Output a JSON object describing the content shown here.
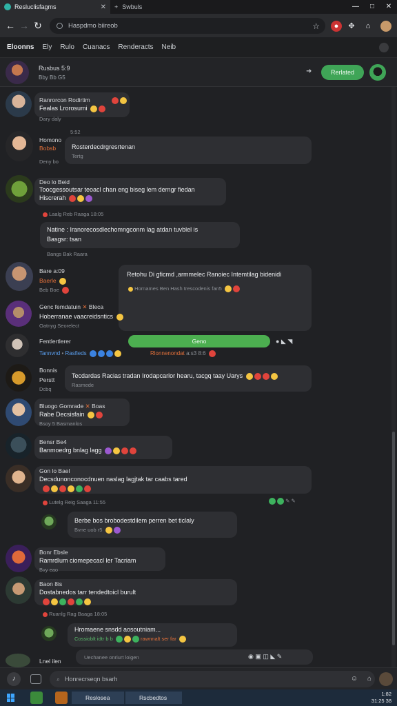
{
  "browser": {
    "active_tab": "Resluclisfagms",
    "inactive_tab": "Swbuls",
    "url": "Haspdmo biireob",
    "window_controls": [
      "—",
      "□",
      "✕"
    ]
  },
  "page_nav": {
    "brand": "Eloonns",
    "links": [
      "Ely",
      "Rulo",
      "Cuanacs",
      "Renderacts",
      "Neib"
    ]
  },
  "chat_header": {
    "name": "Rusbus 5:9",
    "sub": "Bby Bb G5",
    "join_label": "Rerlated"
  },
  "messages": [
    {
      "user": "Ranrorcon Rodirtim",
      "text": "Fealas Lrorosumi",
      "time": "Dary daly"
    },
    {
      "user": "Homono",
      "handle": "Bobsb",
      "time_top": "5:52",
      "text": "Rosterdecdrgresrtenan",
      "sub": "Tertg",
      "time": "Deny bo"
    },
    {
      "user": "Deo lo Beid",
      "text": "Toocgessoutsar teoacl chan eng biseg lem derngr fiedan",
      "text2": "Hiscrerah",
      "meta": "Laalg  Reb  Raaga  18:05"
    },
    {
      "text": "Natine : Iranorecosdlechomngconm lag atdan tuvblel is",
      "text2": "Basgsr: tsan",
      "meta": "Bangs  Bak  Raara"
    },
    {
      "user": "Bare a:09",
      "handle": "Baerle",
      "time": "Beb Boe",
      "reply_text": "Retohu Di gficmd ,armmelec Ranoiec Intemtilag bidenidi",
      "reply_text2": "Hornames  Ben  Hash  trescodenis  fan5"
    },
    {
      "user": "Genc femdatuin",
      "tag": "Bleca",
      "text": "Hoberranae vaacreidsntics",
      "time": "Oatnyg Seorelect"
    },
    {
      "user": "Fentlertlerer",
      "button": "Geno",
      "blue_user": "Tannvnd",
      "blue_time": "Rasfieds",
      "blue_tag": "Rlonnenondat",
      "blue_time2": "a:s3 8:6"
    },
    {
      "user": "Bonnis",
      "handle": "Perstt",
      "text": "Tecdardas Racias tradan Irodapcarlor hearu, tacgq taay Uarys",
      "sub": "Rasmede",
      "time": "Dcbq"
    },
    {
      "user": "Bluogo Gomrade",
      "tag": "Boas",
      "text": "Rabe Decsisfain",
      "time": "Bsoy 5 Basmanlos"
    },
    {
      "user": "Bensr Be4",
      "text": "Banmoedrg bnlag lagg",
      "time": ""
    },
    {
      "user": "Gon lo Bael",
      "text": "Decsdunonconocdnuen naslag lagjtak tar caabs tared",
      "meta": "Lutelg  Reig  Saaga  11:55"
    },
    {
      "text": "Berbe bos brobodestdilem perren bet ticlaly",
      "time": "Bvne uob r5"
    },
    {
      "user": "Bonr Ebsle",
      "text": "Ramrdlum ciomepecacl ler Tacriam",
      "time": "Bvy eao"
    },
    {
      "user": "Baon 8is",
      "text": "Dostabnedos tarr tendedtoicl burult",
      "meta": "Ruanlg  Rag  Baaga  18:05"
    },
    {
      "text": "Hromaene snsdd aosoutniam...",
      "text2": "Cossioblt idtr b b",
      "text3": "rawnnalt ser far"
    },
    {
      "user": "Lnel ilen",
      "bar_text": "Uechanee onriurt loigen"
    }
  ],
  "composer": {
    "placeholder": "Honrecrseqn bsarh"
  },
  "taskbar": {
    "app1": "Reslosea",
    "app2": "Rscbedtos",
    "clock_line1": "1:82",
    "clock_line2": "31:25 38"
  }
}
